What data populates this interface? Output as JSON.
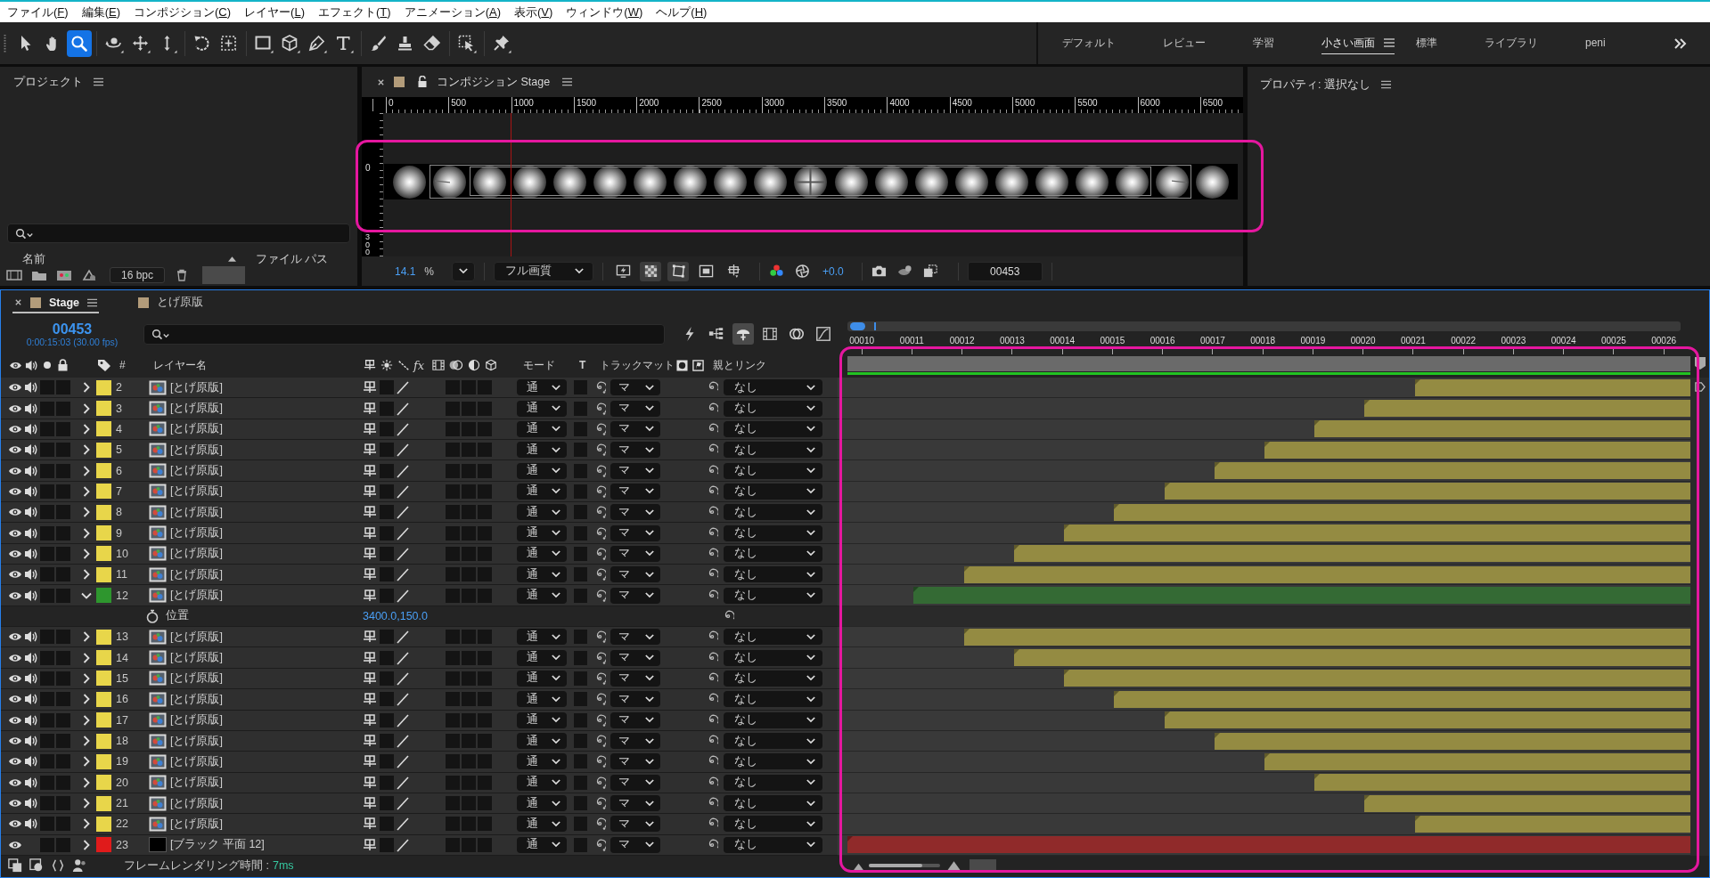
{
  "menu_bar": {
    "items": [
      {
        "label": "ファイル(",
        "mnemonic": "F",
        "suffix": ")"
      },
      {
        "label": "編集(",
        "mnemonic": "E",
        "suffix": ")"
      },
      {
        "label": "コンポジション(",
        "mnemonic": "C",
        "suffix": ")"
      },
      {
        "label": "レイヤー(",
        "mnemonic": "L",
        "suffix": ")"
      },
      {
        "label": "エフェクト(",
        "mnemonic": "T",
        "suffix": ")"
      },
      {
        "label": "アニメーション(",
        "mnemonic": "A",
        "suffix": ")"
      },
      {
        "label": "表示(",
        "mnemonic": "V",
        "suffix": ")"
      },
      {
        "label": "ウィンドウ(",
        "mnemonic": "W",
        "suffix": ")"
      },
      {
        "label": "ヘルプ(",
        "mnemonic": "H",
        "suffix": ")"
      }
    ]
  },
  "toolbar": {
    "tool_groups": [
      {
        "tools": [
          {
            "kind": "selection",
            "selected": false,
            "has_menu": false
          },
          {
            "kind": "hand",
            "selected": false,
            "has_menu": false
          },
          {
            "kind": "zoom",
            "selected": true,
            "has_menu": false
          }
        ]
      },
      {
        "tools": [
          {
            "kind": "orbit",
            "selected": false,
            "has_menu": true
          },
          {
            "kind": "pan",
            "selected": false,
            "has_menu": true
          },
          {
            "kind": "dolly",
            "selected": false,
            "has_menu": true
          }
        ]
      },
      {
        "tools": [
          {
            "kind": "rotate",
            "selected": false,
            "has_menu": false
          },
          {
            "kind": "anchor",
            "selected": false,
            "has_menu": false
          }
        ]
      },
      {
        "tools": [
          {
            "kind": "rectangle",
            "selected": false,
            "has_menu": true
          },
          {
            "kind": "cube",
            "selected": false,
            "has_menu": true
          },
          {
            "kind": "pen",
            "selected": false,
            "has_menu": true
          },
          {
            "kind": "type",
            "selected": false,
            "has_menu": true
          }
        ]
      },
      {
        "tools": [
          {
            "kind": "brush",
            "selected": false,
            "has_menu": false
          },
          {
            "kind": "stamp",
            "selected": false,
            "has_menu": false
          },
          {
            "kind": "eraser",
            "selected": false,
            "has_menu": false
          }
        ]
      },
      {
        "tools": [
          {
            "kind": "roto",
            "selected": false,
            "has_menu": true
          }
        ]
      },
      {
        "tools": [
          {
            "kind": "pin",
            "selected": false,
            "has_menu": true
          }
        ]
      }
    ],
    "workspaces": [
      {
        "label": "デフォルト",
        "selected": false
      },
      {
        "label": "レビュー",
        "selected": false
      },
      {
        "label": "学習",
        "selected": false
      },
      {
        "label": "小さい画面",
        "selected": true
      },
      {
        "label": "標準",
        "selected": false
      },
      {
        "label": "ライブラリ",
        "selected": false
      },
      {
        "label": "peni",
        "selected": false
      }
    ]
  },
  "project_panel": {
    "title": "プロジェクト",
    "columns": [
      "名前",
      "ファイル パス"
    ],
    "bit_depth": "16 bpc"
  },
  "composition_panel": {
    "title": "コンポジション Stage",
    "ruler_labels": [
      "0",
      "500",
      "1000",
      "1500",
      "2000",
      "2500",
      "3000",
      "3500",
      "4000",
      "4500",
      "5000",
      "5500",
      "6000",
      "6500"
    ],
    "vertical_ruler_labels": [
      "0",
      "300"
    ],
    "zoom": "14.1",
    "zoom_unit": "%",
    "resolution": "フル画質",
    "view_toggles": [
      {
        "kind": "fast-preview",
        "on": false
      },
      {
        "kind": "transparency-grid",
        "on": true
      },
      {
        "kind": "mask",
        "on": true
      },
      {
        "kind": "region",
        "on": false
      },
      {
        "kind": "guides",
        "on": false
      }
    ],
    "exposure": "+0.0",
    "timecode": "00453"
  },
  "properties_panel": {
    "title": "プロパティ: 選択なし"
  },
  "timeline": {
    "tabs": [
      {
        "label": "Stage",
        "selected": true
      },
      {
        "label": "とげ原版",
        "selected": false
      }
    ],
    "timecode": "00453",
    "timecode_detail": "0:00:15:03 (30.00 fps)",
    "switches": [
      {
        "kind": "draft-3d",
        "on": false
      },
      {
        "kind": "flowchart",
        "on": false
      },
      {
        "kind": "shy",
        "on": true
      },
      {
        "kind": "frame-blending",
        "on": false
      },
      {
        "kind": "motion-blur",
        "on": false
      },
      {
        "kind": "graph-editor",
        "on": false
      }
    ],
    "columns": {
      "number": "#",
      "layer_name": "レイヤー名",
      "effects": "fx",
      "mode": "モード",
      "preserve_transparency": "T",
      "track_matte": "トラックマット",
      "parent": "親とリンク"
    },
    "ruler_labels": [
      "00010",
      "00011",
      "00012",
      "00013",
      "00014",
      "00015",
      "00016",
      "00017",
      "00018",
      "00019",
      "00020",
      "00021",
      "00022",
      "00023",
      "00024",
      "00025",
      "00026"
    ],
    "layers": [
      {
        "kind": "footage",
        "number": "2",
        "name": "[とげ原版]",
        "color": "#e8d64a",
        "video": true,
        "audio": true,
        "switches": {
          "solo": false,
          "lock": false,
          "collapse": false,
          "motion_blur": false,
          "adjustment": false,
          "three_d": false,
          "preserve_transparency": false
        },
        "expanded": false,
        "mode": "通",
        "track_matte": "マ",
        "parent": "なし",
        "level": 0.323
      },
      {
        "kind": "footage",
        "number": "3",
        "name": "[とげ原版]",
        "color": "#e8d64a",
        "video": true,
        "audio": true,
        "switches": {
          "solo": false,
          "lock": false,
          "collapse": false,
          "motion_blur": false,
          "adjustment": false,
          "three_d": false,
          "preserve_transparency": false
        },
        "expanded": false,
        "mode": "通",
        "track_matte": "マ",
        "parent": "なし",
        "level": 0.382
      },
      {
        "kind": "footage",
        "number": "4",
        "name": "[とげ原版]",
        "color": "#e8d64a",
        "video": true,
        "audio": true,
        "switches": {
          "solo": false,
          "lock": false,
          "collapse": false,
          "motion_blur": false,
          "adjustment": false,
          "three_d": false,
          "preserve_transparency": false
        },
        "expanded": false,
        "mode": "通",
        "track_matte": "マ",
        "parent": "なし",
        "level": 0.441
      },
      {
        "kind": "footage",
        "number": "5",
        "name": "[とげ原版]",
        "color": "#e8d64a",
        "video": true,
        "audio": true,
        "switches": {
          "solo": false,
          "lock": false,
          "collapse": false,
          "motion_blur": false,
          "adjustment": false,
          "three_d": false,
          "preserve_transparency": false
        },
        "expanded": false,
        "mode": "通",
        "track_matte": "マ",
        "parent": "なし",
        "level": 0.499
      },
      {
        "kind": "footage",
        "number": "6",
        "name": "[とげ原版]",
        "color": "#e8d64a",
        "video": true,
        "audio": true,
        "switches": {
          "solo": false,
          "lock": false,
          "collapse": false,
          "motion_blur": false,
          "adjustment": false,
          "three_d": false,
          "preserve_transparency": false
        },
        "expanded": false,
        "mode": "通",
        "track_matte": "マ",
        "parent": "なし",
        "level": 0.558
      },
      {
        "kind": "footage",
        "number": "7",
        "name": "[とげ原版]",
        "color": "#e8d64a",
        "video": true,
        "audio": true,
        "switches": {
          "solo": false,
          "lock": false,
          "collapse": false,
          "motion_blur": false,
          "adjustment": false,
          "three_d": false,
          "preserve_transparency": false
        },
        "expanded": false,
        "mode": "通",
        "track_matte": "マ",
        "parent": "なし",
        "level": 0.617
      },
      {
        "kind": "footage",
        "number": "8",
        "name": "[とげ原版]",
        "color": "#e8d64a",
        "video": true,
        "audio": true,
        "switches": {
          "solo": false,
          "lock": false,
          "collapse": false,
          "motion_blur": false,
          "adjustment": false,
          "three_d": false,
          "preserve_transparency": false
        },
        "expanded": false,
        "mode": "通",
        "track_matte": "マ",
        "parent": "なし",
        "level": 0.676
      },
      {
        "kind": "footage",
        "number": "9",
        "name": "[とげ原版]",
        "color": "#e8d64a",
        "video": true,
        "audio": true,
        "switches": {
          "solo": false,
          "lock": false,
          "collapse": false,
          "motion_blur": false,
          "adjustment": false,
          "three_d": false,
          "preserve_transparency": false
        },
        "expanded": false,
        "mode": "通",
        "track_matte": "マ",
        "parent": "なし",
        "level": 0.735
      },
      {
        "kind": "footage",
        "number": "10",
        "name": "[とげ原版]",
        "color": "#e8d64a",
        "video": true,
        "audio": true,
        "switches": {
          "solo": false,
          "lock": false,
          "collapse": false,
          "motion_blur": false,
          "adjustment": false,
          "three_d": false,
          "preserve_transparency": false
        },
        "expanded": false,
        "mode": "通",
        "track_matte": "マ",
        "parent": "なし",
        "level": 0.793
      },
      {
        "kind": "footage",
        "number": "11",
        "name": "[とげ原版]",
        "color": "#e8d64a",
        "video": true,
        "audio": true,
        "switches": {
          "solo": false,
          "lock": false,
          "collapse": false,
          "motion_blur": false,
          "adjustment": false,
          "three_d": false,
          "preserve_transparency": false
        },
        "expanded": false,
        "mode": "通",
        "track_matte": "マ",
        "parent": "なし",
        "level": 0.852
      },
      {
        "kind": "footage",
        "number": "12",
        "name": "[とげ原版]",
        "color": "#2e962e",
        "video": true,
        "audio": true,
        "switches": {
          "solo": false,
          "lock": false,
          "collapse": false,
          "motion_blur": false,
          "adjustment": false,
          "three_d": false,
          "preserve_transparency": false
        },
        "expanded": true,
        "mode": "通",
        "track_matte": "マ",
        "parent": "なし",
        "level": 0.911,
        "children": [
          {
            "name": "位置",
            "value": "3400.0,150.0"
          }
        ]
      },
      {
        "kind": "footage",
        "number": "13",
        "name": "[とげ原版]",
        "color": "#e8d64a",
        "video": true,
        "audio": true,
        "switches": {
          "solo": false,
          "lock": false,
          "collapse": false,
          "motion_blur": false,
          "adjustment": false,
          "three_d": false,
          "preserve_transparency": false
        },
        "expanded": false,
        "mode": "通",
        "track_matte": "マ",
        "parent": "なし",
        "level": 0.852
      },
      {
        "kind": "footage",
        "number": "14",
        "name": "[とげ原版]",
        "color": "#e8d64a",
        "video": true,
        "audio": true,
        "switches": {
          "solo": false,
          "lock": false,
          "collapse": false,
          "motion_blur": false,
          "adjustment": false,
          "three_d": false,
          "preserve_transparency": false
        },
        "expanded": false,
        "mode": "通",
        "track_matte": "マ",
        "parent": "なし",
        "level": 0.793
      },
      {
        "kind": "footage",
        "number": "15",
        "name": "[とげ原版]",
        "color": "#e8d64a",
        "video": true,
        "audio": true,
        "switches": {
          "solo": false,
          "lock": false,
          "collapse": false,
          "motion_blur": false,
          "adjustment": false,
          "three_d": false,
          "preserve_transparency": false
        },
        "expanded": false,
        "mode": "通",
        "track_matte": "マ",
        "parent": "なし",
        "level": 0.735
      },
      {
        "kind": "footage",
        "number": "16",
        "name": "[とげ原版]",
        "color": "#e8d64a",
        "video": true,
        "audio": true,
        "switches": {
          "solo": false,
          "lock": false,
          "collapse": false,
          "motion_blur": false,
          "adjustment": false,
          "three_d": false,
          "preserve_transparency": false
        },
        "expanded": false,
        "mode": "通",
        "track_matte": "マ",
        "parent": "なし",
        "level": 0.676
      },
      {
        "kind": "footage",
        "number": "17",
        "name": "[とげ原版]",
        "color": "#e8d64a",
        "video": true,
        "audio": true,
        "switches": {
          "solo": false,
          "lock": false,
          "collapse": false,
          "motion_blur": false,
          "adjustment": false,
          "three_d": false,
          "preserve_transparency": false
        },
        "expanded": false,
        "mode": "通",
        "track_matte": "マ",
        "parent": "なし",
        "level": 0.617
      },
      {
        "kind": "footage",
        "number": "18",
        "name": "[とげ原版]",
        "color": "#e8d64a",
        "video": true,
        "audio": true,
        "switches": {
          "solo": false,
          "lock": false,
          "collapse": false,
          "motion_blur": false,
          "adjustment": false,
          "three_d": false,
          "preserve_transparency": false
        },
        "expanded": false,
        "mode": "通",
        "track_matte": "マ",
        "parent": "なし",
        "level": 0.558
      },
      {
        "kind": "footage",
        "number": "19",
        "name": "[とげ原版]",
        "color": "#e8d64a",
        "video": true,
        "audio": true,
        "switches": {
          "solo": false,
          "lock": false,
          "collapse": false,
          "motion_blur": false,
          "adjustment": false,
          "three_d": false,
          "preserve_transparency": false
        },
        "expanded": false,
        "mode": "通",
        "track_matte": "マ",
        "parent": "なし",
        "level": 0.499
      },
      {
        "kind": "footage",
        "number": "20",
        "name": "[とげ原版]",
        "color": "#e8d64a",
        "video": true,
        "audio": true,
        "switches": {
          "solo": false,
          "lock": false,
          "collapse": false,
          "motion_blur": false,
          "adjustment": false,
          "three_d": false,
          "preserve_transparency": false
        },
        "expanded": false,
        "mode": "通",
        "track_matte": "マ",
        "parent": "なし",
        "level": 0.441
      },
      {
        "kind": "footage",
        "number": "21",
        "name": "[とげ原版]",
        "color": "#e8d64a",
        "video": true,
        "audio": true,
        "switches": {
          "solo": false,
          "lock": false,
          "collapse": false,
          "motion_blur": false,
          "adjustment": false,
          "three_d": false,
          "preserve_transparency": false
        },
        "expanded": false,
        "mode": "通",
        "track_matte": "マ",
        "parent": "なし",
        "level": 0.382
      },
      {
        "kind": "footage",
        "number": "22",
        "name": "[とげ原版]",
        "color": "#e8d64a",
        "video": true,
        "audio": true,
        "switches": {
          "solo": false,
          "lock": false,
          "collapse": false,
          "motion_blur": false,
          "adjustment": false,
          "three_d": false,
          "preserve_transparency": false
        },
        "expanded": false,
        "mode": "通",
        "track_matte": "マ",
        "parent": "なし",
        "level": 0.323
      },
      {
        "kind": "solid",
        "number": "23",
        "name": "[ブラック 平面 12]",
        "color": "#e01b1b",
        "video": true,
        "audio": false,
        "switches": {
          "solo": false,
          "lock": false,
          "collapse": false,
          "motion_blur": false,
          "adjustment": false,
          "three_d": false,
          "preserve_transparency": false
        },
        "expanded": false,
        "mode": "通",
        "track_matte": "マ",
        "parent": "なし",
        "level": 0.989
      }
    ],
    "status_bar": {
      "label": "フレームレンダリング時間 :",
      "value": "7ms",
      "zoom_slider": {
        "level": 0.75
      }
    }
  }
}
